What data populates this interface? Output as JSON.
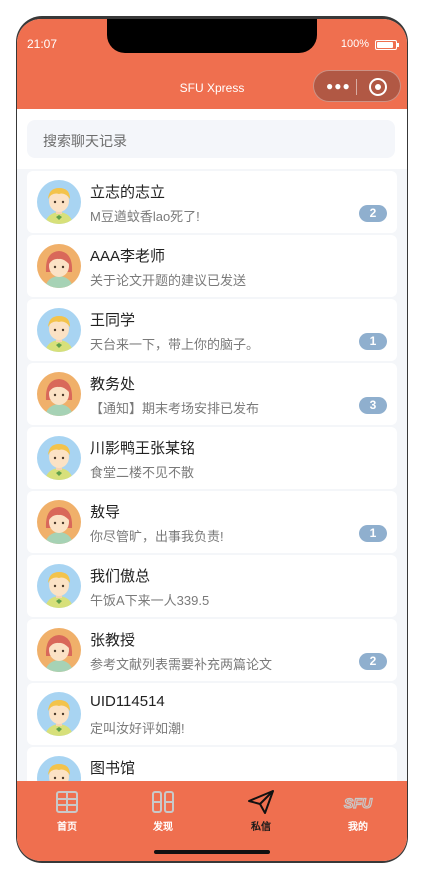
{
  "status_bar": {
    "time": "21:07",
    "battery_text": "100%"
  },
  "header": {
    "title": "SFU Xpress",
    "more_icon": "more-dots-icon",
    "close_icon": "target-circle-icon"
  },
  "search": {
    "placeholder": "搜索聊天记录"
  },
  "chats": [
    {
      "name": "立志的志立",
      "message": "M豆遒蚊香lao死了!",
      "badge": "2",
      "avatar": "boy"
    },
    {
      "name": "AAA李老师",
      "message": "关于论文开题的建议已发送",
      "badge": "",
      "avatar": "girl"
    },
    {
      "name": "王同学",
      "message": "天台来一下，带上你的脑子。",
      "badge": "1",
      "avatar": "boy"
    },
    {
      "name": "教务处",
      "message": "【通知】期末考场安排已发布",
      "badge": "3",
      "avatar": "girl"
    },
    {
      "name": "川影鸭王张某铭",
      "message": "食堂二楼不见不散",
      "badge": "",
      "avatar": "boy"
    },
    {
      "name": "敖导",
      "message": "你尽管旷，出事我负责!",
      "badge": "1",
      "avatar": "girl"
    },
    {
      "name": "我们傲总",
      "message": "午饭A下来一人339.5",
      "badge": "",
      "avatar": "boy"
    },
    {
      "name": "张教授",
      "message": "参考文献列表需要补充两篇论文",
      "badge": "2",
      "avatar": "girl"
    },
    {
      "name": "UID114514",
      "message": "定叫汝好评如潮!",
      "badge": "",
      "avatar": "boy"
    },
    {
      "name": "图书馆",
      "message": "",
      "badge": "",
      "avatar": "boy"
    }
  ],
  "tabs": [
    {
      "label": "首页",
      "icon": "home-grid-icon",
      "active": false
    },
    {
      "label": "发现",
      "icon": "discover-icon",
      "active": false
    },
    {
      "label": "私信",
      "icon": "paper-plane-icon",
      "active": true
    },
    {
      "label": "我的",
      "icon": "sfu-logo-icon",
      "active": false
    }
  ],
  "colors": {
    "accent": "#ef6f4f",
    "badge": "#8fafce",
    "background": "#f4f6f9"
  }
}
